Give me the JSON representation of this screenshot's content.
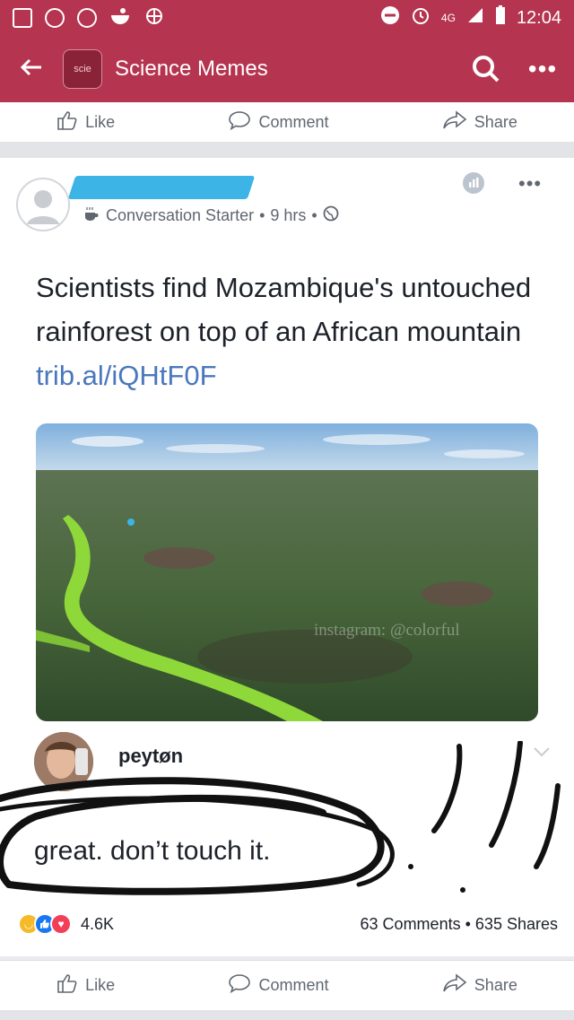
{
  "status_bar": {
    "time": "12:04",
    "network": "4G"
  },
  "app_bar": {
    "group_thumb_text": "scie",
    "title": "Science Memes"
  },
  "actions": {
    "like": "Like",
    "comment": "Comment",
    "share": "Share"
  },
  "post": {
    "meta_tag": "Conversation Starter",
    "time": "9 hrs",
    "text": "Scientists find Mozambique's untouched rainforest on top of an African mountain",
    "link": "trib.al/iQHtF0F",
    "image_watermark": "instagram: @colorful"
  },
  "reply": {
    "name": "peytøn",
    "text": "great.  don’t touch it."
  },
  "engagement": {
    "reactions": "4.6K",
    "comments": "63 Comments",
    "separator": "•",
    "shares": "635 Shares"
  },
  "colors": {
    "header": "#b5344f",
    "link": "#4a78bd",
    "redaction": "#3cb5e6"
  }
}
